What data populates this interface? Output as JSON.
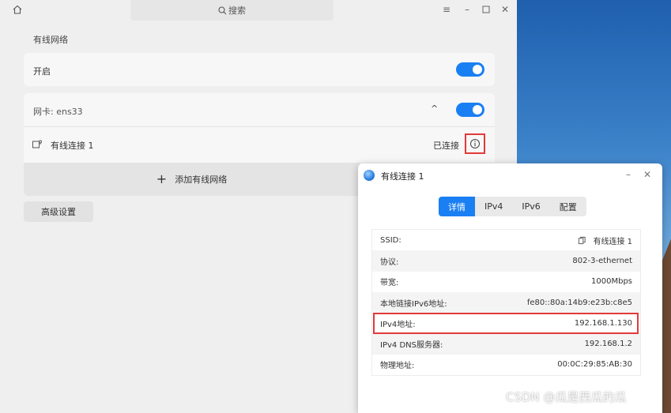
{
  "window": {
    "search_label": "搜索",
    "section_title": "有线网络"
  },
  "enable_row": {
    "label": "开启",
    "toggle_on": true
  },
  "nic_row": {
    "label": "网卡: ens33",
    "toggle_on": true
  },
  "connection": {
    "name": "有线连接 1",
    "status": "已连接"
  },
  "add_button": {
    "label": "添加有线网络"
  },
  "advanced_button": {
    "label": "高级设置"
  },
  "dialog": {
    "title": "有线连接 1",
    "tabs": [
      {
        "label": "详情",
        "active": true
      },
      {
        "label": "IPv4",
        "active": false
      },
      {
        "label": "IPv6",
        "active": false
      },
      {
        "label": "配置",
        "active": false
      }
    ],
    "details": [
      {
        "key": "SSID:",
        "value": "有线连接 1"
      },
      {
        "key": "协议:",
        "value": "802-3-ethernet"
      },
      {
        "key": "带宽:",
        "value": "1000Mbps"
      },
      {
        "key": "本地链接IPv6地址:",
        "value": "fe80::80a:14b9:e23b:c8e5"
      },
      {
        "key": "IPv4地址:",
        "value": "192.168.1.130"
      },
      {
        "key": "IPv4 DNS服务器:",
        "value": "192.168.1.2"
      },
      {
        "key": "物理地址:",
        "value": "00:0C:29:85:AB:30"
      }
    ]
  },
  "watermark": "CSDN @瓜是西瓜的瓜",
  "colors": {
    "accent": "#1a7ff2",
    "highlight": "#e23a3a"
  }
}
